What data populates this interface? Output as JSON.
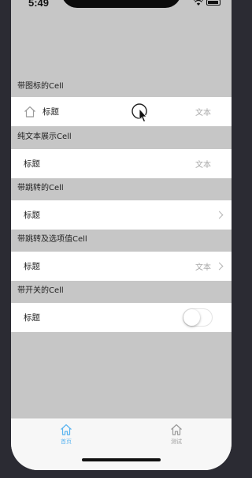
{
  "status_bar": {
    "time": "5:49"
  },
  "sections": [
    {
      "header": "带图标的Cell",
      "cell": {
        "title": "标题",
        "detail": "文本",
        "icon": "home-outline-icon"
      }
    },
    {
      "header": "纯文本展示Cell",
      "cell": {
        "title": "标题",
        "detail": "文本"
      }
    },
    {
      "header": "带跳转的Cell",
      "cell": {
        "title": "标题"
      }
    },
    {
      "header": "带跳转及选项值Cell",
      "cell": {
        "title": "标题",
        "detail": "文本"
      }
    },
    {
      "header": "带开关的Cell",
      "cell": {
        "title": "标题",
        "switch_on": false
      }
    }
  ],
  "tabbar": {
    "tabs": [
      {
        "label": "首页",
        "icon": "home-icon",
        "selected": true
      },
      {
        "label": "测试",
        "icon": "home-icon",
        "selected": false
      }
    ]
  },
  "colors": {
    "accent": "#5ab4f0",
    "inactive": "#9a9a9a",
    "background": "#c6c6c6",
    "detail_text": "#a8a8a8"
  }
}
